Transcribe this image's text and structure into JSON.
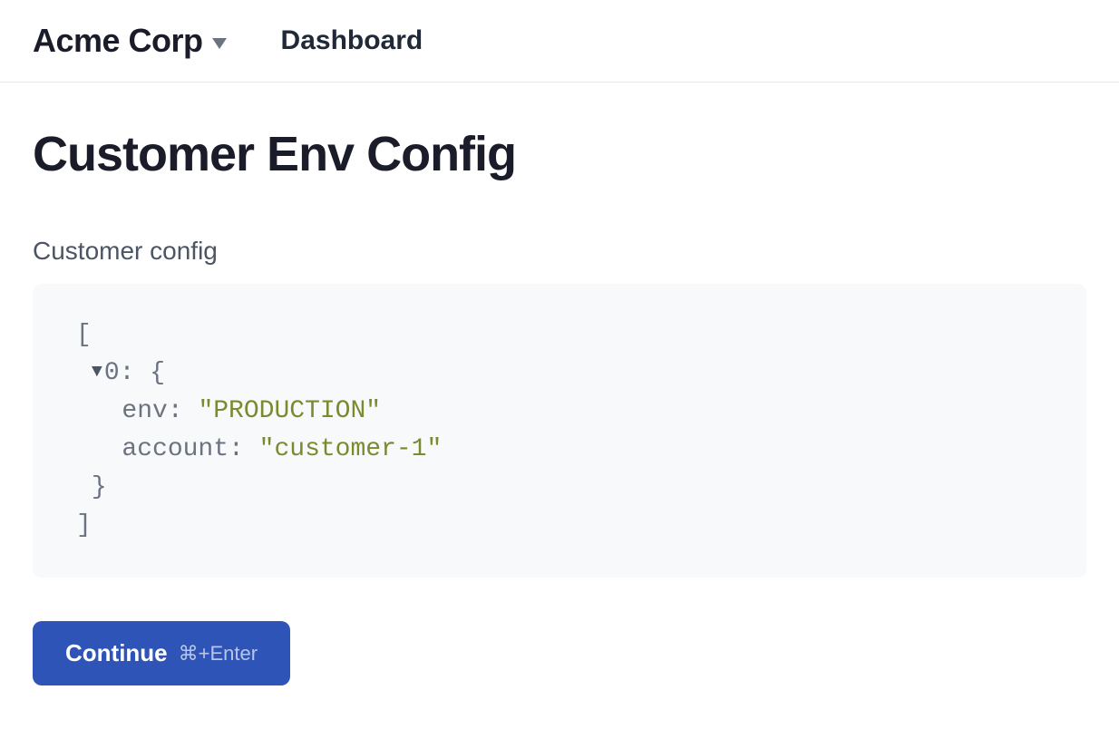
{
  "header": {
    "org_name": "Acme Corp",
    "nav_dashboard": "Dashboard"
  },
  "main": {
    "page_title": "Customer Env Config",
    "field_label": "Customer config",
    "continue_label": "Continue",
    "continue_shortcut": "⌘+Enter"
  },
  "config": {
    "open_bracket": "[",
    "index": "0",
    "open_brace": "{",
    "key_env": "env",
    "val_env": "\"PRODUCTION\"",
    "key_account": "account",
    "val_account": "\"customer-1\"",
    "close_brace": "}",
    "close_bracket": "]"
  }
}
